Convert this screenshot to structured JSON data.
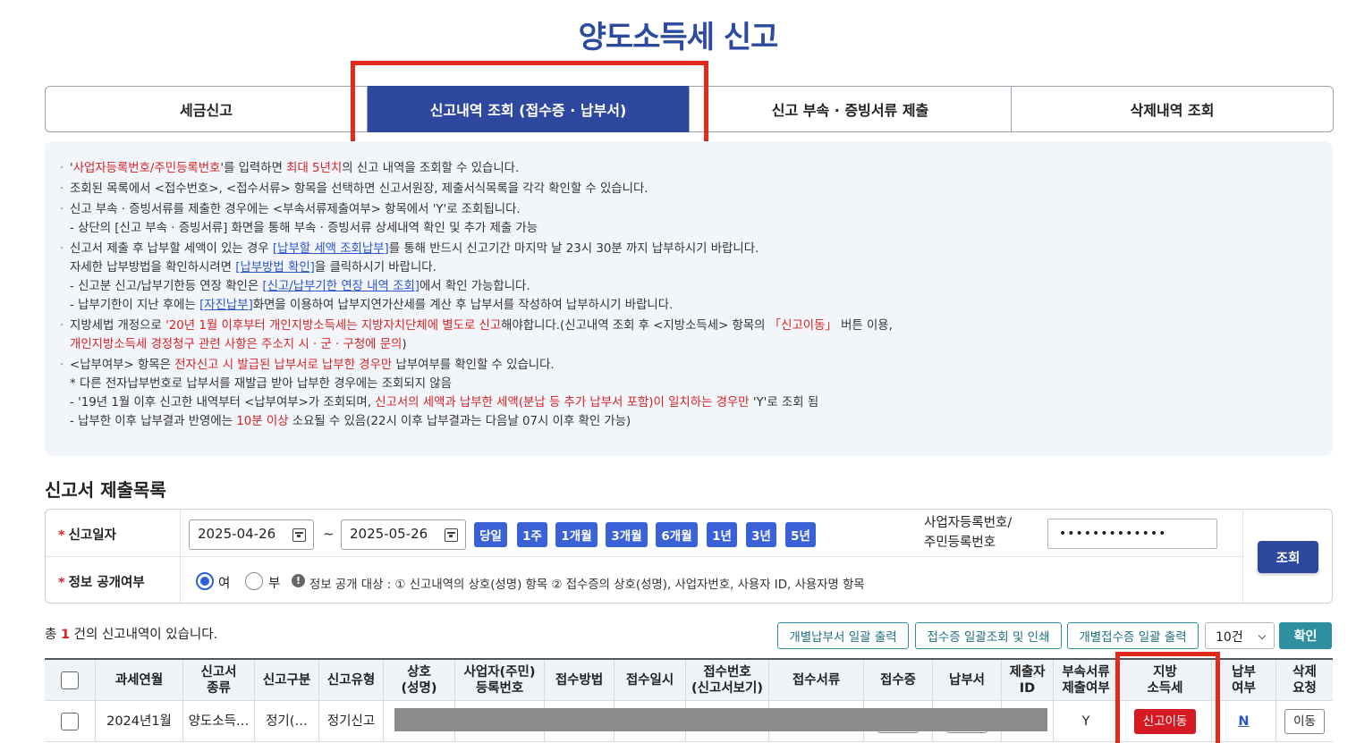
{
  "page": {
    "title": "양도소득세 신고"
  },
  "tabs": [
    {
      "label": "세금신고"
    },
    {
      "label": "신고내역 조회 (접수증 · 납부서)"
    },
    {
      "label": "신고 부속 · 증빙서류 제출"
    },
    {
      "label": "삭제내역 조회"
    }
  ],
  "notice": {
    "b1": {
      "q1": "'",
      "r1": "사업자등록번호/주민등록번호",
      "t1": "'를 입력하면 ",
      "r2": "최대 5년치",
      "t2": "의 신고 내역을 조회할 수 있습니다."
    },
    "b2": {
      "t1": "조회된 목록에서 <접수번호>, <접수서류> 항목을 선택하면 신고서원장, 제출서식목록을 각각 확인할 수 있습니다."
    },
    "b3": {
      "t1": "신고 부속 · 증빙서류를 제출한 경우에는 <부속서류제출여부> 항목에서 'Y'로 조회됩니다.",
      "t2": "- 상단의 [신고 부속 · 증빙서류] 화면을 통해 부속 · 증빙서류 상세내역 확인 및 추가 제출 가능"
    },
    "b4": {
      "t1": "신고서 제출 후 납부할 세액이 있는 경우 ",
      "l1": "[납부할 세액 조회납부]",
      "t2": "를 통해 반드시 신고기간 마지막 날 23시 30분 까지 납부하시기 바랍니다.",
      "t3": "자세한 납부방법을 확인하시려면 ",
      "l2": "[납부방법 확인]",
      "t4": "을 클릭하시기 바랍니다.",
      "t5": "- 신고분 신고/납부기한등 연장 확인은 ",
      "l3": "[신고/납부기한 연장 내역 조회]",
      "t6": "에서 확인 가능합니다.",
      "t7": "- 납부기한이 지난 후에는 ",
      "l4": "[자진납부]",
      "t8": "화면을 이용하여 납부지연가산세를 계산 후 납부서를 작성하여 납부하시기 바랍니다."
    },
    "b5": {
      "t1": "지방세법 개정으로 ",
      "r1": "'20년 1월 이후부터 개인지방소득세는 지방자치단체에 별도로 신고",
      "t2": "해야합니다.(신고내역 조회 후 <지방소득세> 항목의 ",
      "r2": "「신고이동」",
      "t3": " 버튼 이용,",
      "r3": "개인지방소득세 경정청구 관련 사항은 주소지 시 · 군 · 구청에 문의",
      "t4": ")"
    },
    "b6": {
      "t1": "<납부여부> 항목은 ",
      "r1": "전자신고 시 발급된 납부서로 납부한 경우만",
      "t2": " 납부여부를 확인할 수 있습니다.",
      "t3": " * 다른 전자납부번호로 납부서를 재발급 받아 납부한 경우에는 조회되지 않음",
      "t4": "- '19년 1월 이후 신고한 내역부터 <납부여부>가 조회되며, ",
      "r2": "신고서의 세액과 납부한 세액(분납 등 추가 납부서 포함)이 일치하는 경우만",
      "t5": " 'Y'로 조회 됨",
      "t6": "- 납부한 이후 납부결과 반영에는 ",
      "r3": "10분 이상",
      "t7": " 소요될 수 있음(22시 이후 납부결과는 다음날 07시 이후 확인 가능)"
    }
  },
  "section": {
    "title": "신고서 제출목록"
  },
  "search": {
    "date_label": "신고일자",
    "date_from": "2025-04-26",
    "tilde": "~",
    "date_to": "2025-05-26",
    "periods": [
      "당일",
      "1주",
      "1개월",
      "3개월",
      "6개월",
      "1년",
      "3년",
      "5년"
    ],
    "biz_label_1": "사업자등록번호/",
    "biz_label_2": "주민등록번호",
    "biz_value": "•••••••••••••",
    "search_btn": "조회",
    "public_label": "정보 공개여부",
    "opt_yes": "여",
    "opt_no": "부",
    "selected": "여",
    "info_icon": "!",
    "info_text": "정보 공개 대상 : ① 신고내역의 상호(성명) 항목 ② 접수증의 상호(성명), 사업자번호, 사용자 ID, 사용자명 항목"
  },
  "results": {
    "count_prefix": "총 ",
    "count": "1",
    "count_suffix": " 건의 신고내역이 있습니다.",
    "btn_payslip": "개별납부서 일괄 출력",
    "btn_receipt": "접수증 일괄조회 및 인쇄",
    "btn_indiv_receipt": "개별접수증 일괄 출력",
    "page_size": "10건",
    "confirm": "확인"
  },
  "table": {
    "headers": {
      "year_month": "과세연월",
      "doc_type_1": "신고서",
      "doc_type_2": "종류",
      "report_div": "신고구분",
      "report_type": "신고유형",
      "name_1": "상호",
      "name_2": "(성명)",
      "biz_no_1": "사업자(주민)",
      "biz_no_2": "등록번호",
      "method": "접수방법",
      "date": "접수일시",
      "rcpt_no_1": "접수번호",
      "rcpt_no_2": "(신고서보기)",
      "docs": "접수서류",
      "receipt": "접수증",
      "payslip": "납부서",
      "submitter_1": "제출자",
      "submitter_2": "ID",
      "attach_1": "부속서류",
      "attach_2": "제출여부",
      "local_1": "지방",
      "local_2": "소득세",
      "paid_1": "납부",
      "paid_2": "여부",
      "delete_1": "삭제",
      "delete_2": "요청"
    },
    "rows": [
      {
        "year_month": "2024년1월",
        "doc_type": "양도소득…",
        "report_div": "정기(…",
        "report_type": "정기신고",
        "attach": "Y",
        "local_btn": "신고이동",
        "paid": "N",
        "delete_btn": "이동"
      }
    ]
  },
  "colors": {
    "primary": "#2e48a0",
    "highlight_red": "#e02a1a",
    "teal": "#2e8fa0",
    "red_text": "#d82222"
  }
}
